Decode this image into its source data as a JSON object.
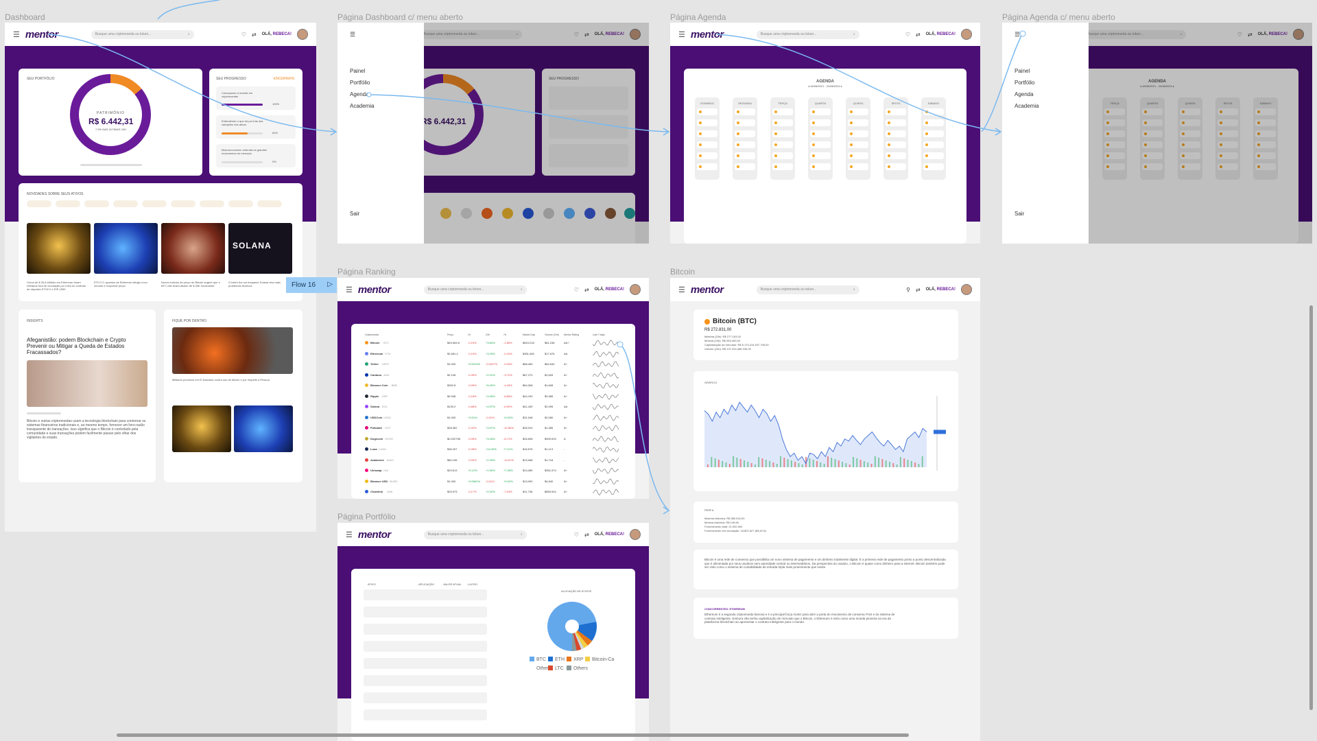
{
  "frames": {
    "dashboard": {
      "label": "Dashboard"
    },
    "dashboard_menu": {
      "label": "Página Dashboard c/ menu aberto"
    },
    "agenda": {
      "label": "Página Agenda"
    },
    "agenda_menu": {
      "label": "Página Agenda c/ menu aberto"
    },
    "ranking": {
      "label": "Página Ranking"
    },
    "bitcoin": {
      "label": "Bitcoin"
    },
    "portfolio": {
      "label": "Página Portfólio"
    }
  },
  "header": {
    "logo": "mentor",
    "search_placeholder": "Busque uma criptomoeda ou token...",
    "greeting_prefix": "OLÁ,",
    "greeting_name": "REBECA!"
  },
  "dashboard": {
    "portfolio_title": "SEU PORTFÓLIO",
    "patrimonio_label": "PATRIMÔNIO",
    "patrimonio_value": "R$ 6.442,31",
    "patrimonio_change": "7.9% NAS ÚLTIMAS 24H",
    "progress_title": "SEU PROGRESSO",
    "progress_link": "ENCERRATE",
    "progress_items": [
      {
        "text": "Começando a investir em criptomoedas",
        "pct": "100%",
        "value": 1.0,
        "color": "#6a1b9a"
      },
      {
        "text": "Entendendo o que há por trás das variações dos ativos",
        "pct": "64%",
        "value": 0.64,
        "color": "#f08a24"
      },
      {
        "text": "Macroeconomia: entenda os grandes movimentos do mercado",
        "pct": "0%",
        "value": 0.0,
        "color": "#6a1b9a"
      }
    ],
    "news_title": "NOVIDADES SOBRE SEUS ATIVOS",
    "news_captions": [
      "Cerca de $ 26,8 bilhões em Ethereum foram retirados fora de circulação por meio do contrato de depósito ETH2.0 e EIP-1559",
      "ETH 2.0: quantos de Ethereum atingiu novo recorde e responde preço",
      "Novos indícios de preço do Bitcoin sugere que o BTC não ficará abaixo de $ 39K novamente",
      "O token the sol enquanto Solana visa mais problemas técnicos"
    ],
    "solana_text": "SOLANA",
    "insights_title": "INSIGHTS",
    "insights_headline": "Afeganistão: podem Blockchain e Crypto Prevenir ou Mitigar a Queda de Estados Fracassados?",
    "insights_body": "Bitcoin e outras criptomoedas usam a tecnologia blockchain para contornar os sistemas financeiros tradicionais e, ao mesmo tempo, fornecer um livro-razão transparente de transações. Isso significa que o Bitcoin é controlado pela comunidade e suas transações podem facilmente passar pelo olhar dos vigilantes do estado.",
    "stay_title": "FIQUE POR DENTRO",
    "stay_caption": "Militares próximos em El Salvador contra uso de bitcoin e por respeito à Pessoa"
  },
  "menu": {
    "items": [
      "Painel",
      "Portfólio",
      "Agenda",
      "Academia"
    ],
    "exit": "Sair"
  },
  "agenda": {
    "title": "AGENDA",
    "range": "◂ 18/08/2021 - 24/08/2021 ▸",
    "days": [
      "DOMINGO",
      "SEGUNDA",
      "TERÇA",
      "QUARTA",
      "QUINTA",
      "SEXTA",
      "SÁBADO"
    ]
  },
  "ranking": {
    "columns": [
      "Criptomoeda",
      "Preço",
      "1h",
      "24h",
      "7d",
      "Market Cap",
      "Volume (24h)",
      "Mentor Rating",
      "Last 7 days"
    ],
    "rows": [
      [
        "Bitcoin",
        "BTC",
        "$43,963.8",
        "-0.19%",
        "+3.84%",
        "-1.85%",
        "$815,218",
        "$81,238",
        "AA+",
        "#f7931a"
      ],
      [
        "Ethereum",
        "ETH",
        "$2,981.4",
        "-0.19%",
        "+3.29%",
        "-0.15%",
        "$351,065",
        "$17,676",
        "AA",
        "#627eea"
      ],
      [
        "Tether",
        "USDT",
        "$1.000",
        "+0.0019%",
        "-0.0047%",
        "-0.03%",
        "$68,469",
        "$64,540",
        "A+",
        "#26a17b"
      ],
      [
        "Cardano",
        "ADA",
        "$2.108",
        "-0.39%",
        "+2.21%",
        "-3.72%",
        "$67,270",
        "$2,605",
        "A+",
        "#0033ad"
      ],
      [
        "Binance Coin",
        "BNB",
        "$392.8",
        "-0.09%",
        "+5.40%",
        "-4.43%",
        "$64,308",
        "$1,608",
        "A+",
        "#f3ba2f"
      ],
      [
        "Ripple",
        "XRP",
        "$0.948",
        "-0.18%",
        "+3.39%",
        "-8.85%",
        "$44,190",
        "$3,385",
        "A+",
        "#23292f"
      ],
      [
        "Solana",
        "SOL",
        "$139.2",
        "-0.68%",
        "+4.97%",
        "-6.90%",
        "$41,439",
        "$2,995",
        "AA",
        "#9945ff"
      ],
      [
        "USDCoin",
        "USDC",
        "$1.000",
        "+0.01%",
        "-0.01%",
        "+0.02%",
        "$31,048",
        "$2,080",
        "A+",
        "#2775ca"
      ],
      [
        "Polkadot",
        "DOT",
        "$28.362",
        "-0.42%",
        "+3.37%",
        "-10.86%",
        "$28,910",
        "$1,385",
        "A+",
        "#e6007a"
      ],
      [
        "Dogecoin",
        "DOGE",
        "$0.202798",
        "-0.05%",
        "+3.18%",
        "-8.71%",
        "$26,698",
        "$909,003",
        "A",
        "#c2a633"
      ],
      [
        "Luna",
        "LUNA",
        "$36.407",
        "-0.39%",
        "+14.20%",
        "+7.11%",
        "$15,576",
        "$1,113",
        "-",
        "#172852"
      ],
      [
        "Avalanche",
        "AVAX",
        "$60.196",
        "-0.09%",
        "+2.29%",
        "-13.67%",
        "$13,068",
        "$1,718",
        "-",
        "#e84142"
      ],
      [
        "Uniswap",
        "UNI",
        "$23.613",
        "+0.12%",
        "+1.50%",
        "+7.28%",
        "$14,089",
        "$352,374",
        "A+",
        "#ff007a"
      ],
      [
        "Binance USD",
        "BUSD",
        "$1.000",
        "+0.0061%",
        "-0.01%",
        "+0.02%",
        "$13,090",
        "$4,840",
        "A+",
        "#f0b90b"
      ],
      [
        "Chainlink",
        "LINK",
        "$25.973",
        "-0.17%",
        "+4.32%",
        "-7.04%",
        "$11,738",
        "$859,944",
        "A+",
        "#2a5ada"
      ]
    ]
  },
  "bitcoin": {
    "name": "Bitcoin (BTC)",
    "price": "R$ 272.831,00",
    "stats": [
      "Máxima (24h): R$ 277.163,00",
      "Mínima (24h): R$ 263.453,00",
      "Capitalização de mercado: R$ 5.170.414.947.706,00",
      "Volume (24h): R$ 137.334.488.230,00"
    ],
    "chart_label": "GRÁFICO",
    "profile_label": "PERFIL",
    "profile_stats": [
      "Máxima histórica: R$ 380.542,00",
      "Mínima histórica: R$ 149,66",
      "Fornecimento total: 21.000.000",
      "Fornecimento em circulação: 18.801.627 (89,61%)"
    ],
    "about": "Bitcoin é uma rede de consenso que possibilita um novo sistema de pagamento e um dinheiro totalmente digital. É a primeira rede de pagamento ponto a ponto descentralizada que é alimentada por seus usuários sem autoridade central ou intermediários. Da perspectiva do usuário, o Bitcoin é quase como dinheiro para a internet. Bitcoin também pode ser visto como o sistema de contabilidade de entrada tripla mais proeminente que existe.",
    "competitor_label": "CONCORRENTES: ETHEREUM",
    "competitor_text": "Ethereum é a segunda criptomoeda famosa e é a principal força motriz para abrir a porta do mecanismo de consenso PoS e do sistema de contrato inteligente. Embora não tenha capitalização de mercado que o Bitcoin, o Ethereum é visto como uma moeda pioneira na era da plataforma blockchain ao apresentar o contrato inteligente para o mundo."
  },
  "portfolio": {
    "columns": [
      "ATIVO",
      "APLICAÇÃO",
      "VALOR ATUAL",
      "LUCRO"
    ],
    "alloc_title": "ALOCAÇÃO DE ATIVOS",
    "legend": [
      {
        "label": "BTC",
        "color": "#64a8ec"
      },
      {
        "label": "ETH",
        "color": "#1e6fd0"
      },
      {
        "label": "XRP",
        "color": "#e8761a"
      },
      {
        "label": "Bitcoin-Ca",
        "color": "#f3cd43"
      },
      {
        "label": "Others",
        "color": "#ffffff"
      },
      {
        "label": "LTC",
        "color": "#d9482b"
      },
      {
        "label": "Others",
        "color": "#8a9a9a"
      }
    ]
  },
  "flow": {
    "label": "Flow 16"
  },
  "chart_data": {
    "type": "line",
    "title": "GRÁFICO",
    "xlabel": "",
    "ylabel": "",
    "series": [
      {
        "values": [
          24300,
          24250,
          24150,
          24280,
          24200,
          24320,
          24250,
          24380,
          24300,
          24420,
          24350,
          24280,
          24380,
          24300,
          24200,
          24320,
          24260,
          24150,
          24230,
          24100,
          23900,
          23750,
          23650,
          23700,
          23600,
          23650,
          23550,
          23700,
          23680,
          23620,
          23720,
          23650,
          23780,
          23720,
          23850,
          23800,
          23900,
          23870,
          23950,
          23880,
          23820,
          23900,
          23950,
          24000,
          23920,
          23850,
          23800,
          23880,
          23820,
          23750,
          23800,
          23720,
          23900,
          23950,
          24000,
          23920,
          24050,
          24000
        ]
      }
    ],
    "colors": [
      "#4a78d8"
    ],
    "volume_colors": [
      "#e7858a",
      "#7ec8a2"
    ]
  }
}
